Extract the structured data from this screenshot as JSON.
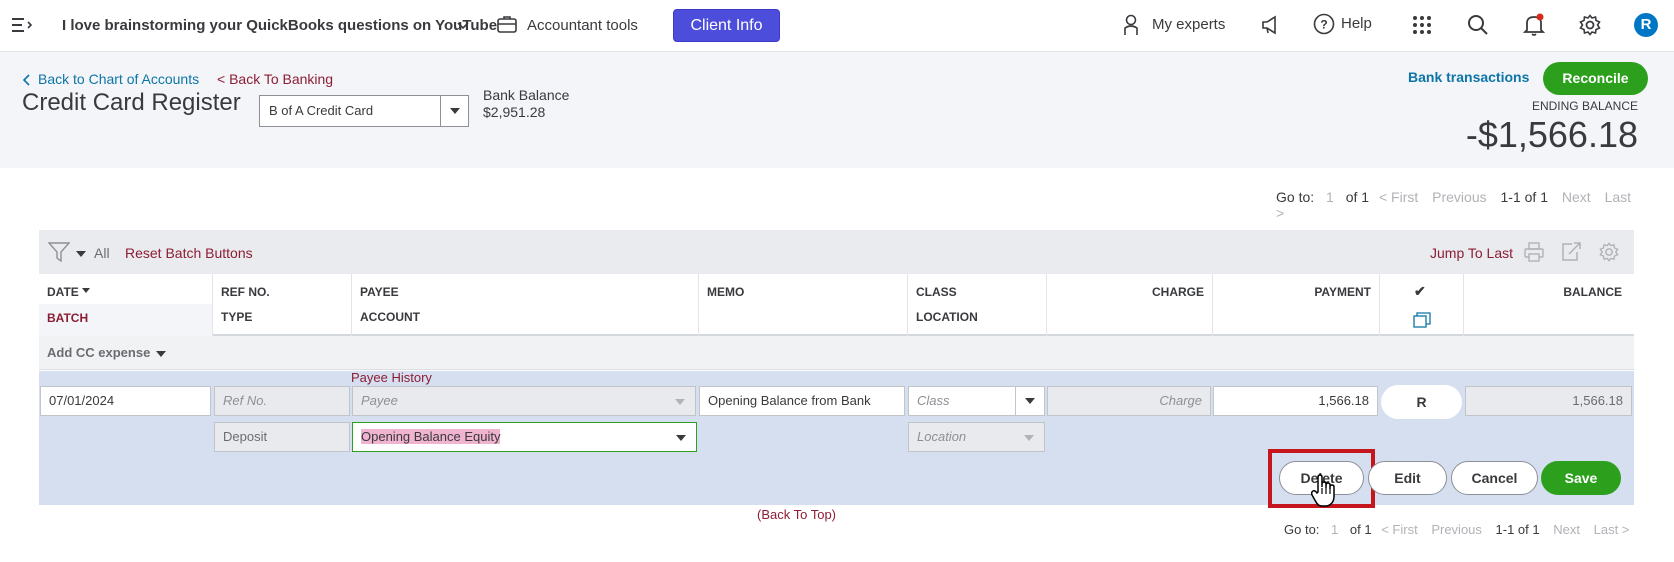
{
  "topnav": {
    "company": "I love brainstorming your QuickBooks questions on YouTube",
    "accountant_tools": "Accountant tools",
    "client_info": "Client Info",
    "my_experts": "My experts",
    "help": "Help",
    "avatar": "R"
  },
  "header": {
    "back_chart": "Back to Chart of Accounts",
    "back_banking": "< Back To Banking",
    "title": "Credit Card Register",
    "account_select": "B of A Credit Card",
    "bank_balance_label": "Bank Balance",
    "bank_balance_value": "$2,951.28",
    "bank_transactions": "Bank transactions",
    "reconcile": "Reconcile",
    "ending_balance_label": "ENDING BALANCE",
    "ending_balance_value": "-$1,566.18"
  },
  "pagination": {
    "goto": "Go to:",
    "page": "1",
    "of": "of 1",
    "first": "< First",
    "previous": "Previous",
    "range": "1-1 of 1",
    "next": "Next",
    "last": "Last >"
  },
  "toolbar": {
    "filter_all": "All",
    "reset_batch": "Reset Batch Buttons",
    "jump_to_last": "Jump To Last"
  },
  "columns": {
    "date": "DATE",
    "batch": "BATCH",
    "ref_no": "REF NO.",
    "type": "TYPE",
    "payee": "PAYEE",
    "account": "ACCOUNT",
    "memo": "MEMO",
    "class": "CLASS",
    "location": "LOCATION",
    "charge": "CHARGE",
    "payment": "PAYMENT",
    "check": "✔",
    "balance": "BALANCE"
  },
  "add_row": "Add CC expense",
  "edit_row": {
    "payee_history": "Payee History",
    "date": "07/01/2024",
    "ref_placeholder": "Ref No.",
    "payee_placeholder": "Payee",
    "memo": "Opening Balance from Bank",
    "class_placeholder": "Class",
    "charge_placeholder": "Charge",
    "payment": "1,566.18",
    "reconcile_status": "R",
    "balance": "1,566.18",
    "type": "Deposit",
    "account": "Opening Balance Equity",
    "location_placeholder": "Location"
  },
  "actions": {
    "delete": "Delete",
    "edit": "Edit",
    "cancel": "Cancel",
    "save": "Save"
  },
  "back_to_top": "(Back To Top)"
}
